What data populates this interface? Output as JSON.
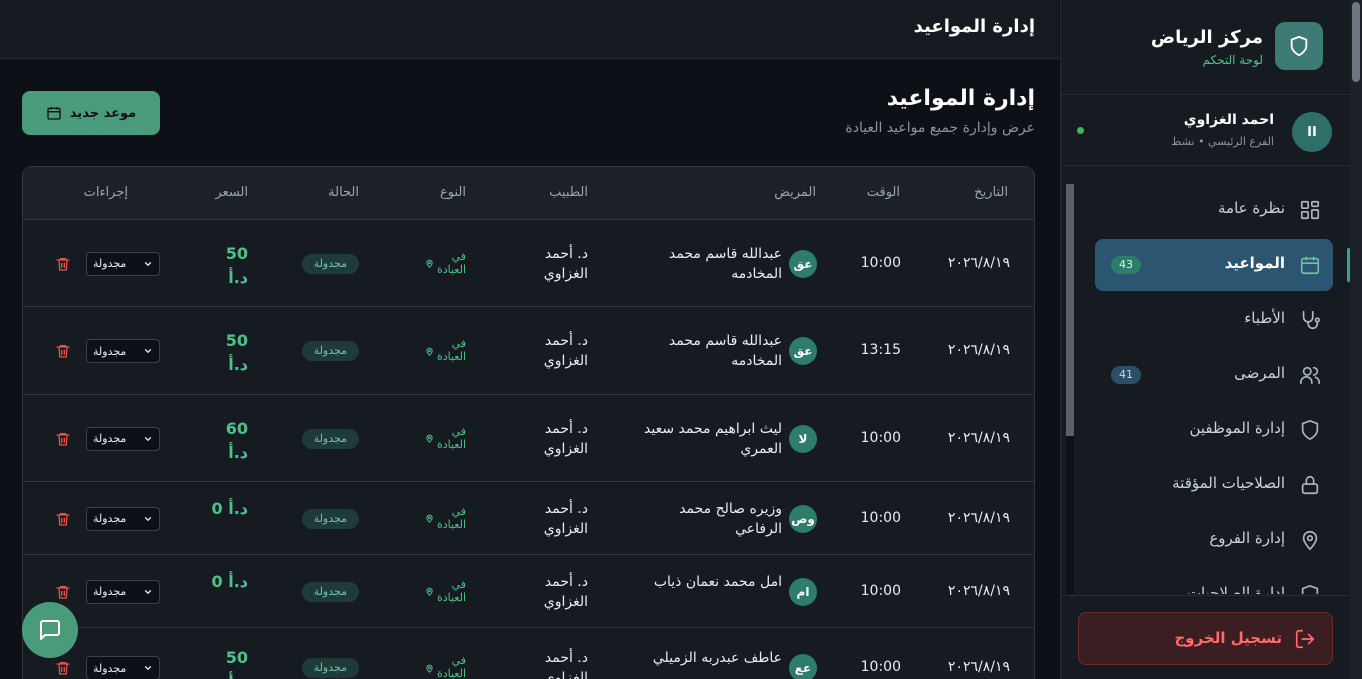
{
  "topbar": {
    "title": "إدارة المواعيد"
  },
  "brand": {
    "title": "مركز الرياض",
    "subtitle": "لوحة التحكم",
    "logo_icon": "shield-icon"
  },
  "user": {
    "initials": "II",
    "name": "احمد الغزاوي",
    "meta": "الفرع الرئيسي • نشط"
  },
  "nav": [
    {
      "label": "نظرة عامة",
      "icon": "grid-icon"
    },
    {
      "label": "المواعيد",
      "icon": "calendar-icon",
      "badge": "43",
      "active": true
    },
    {
      "label": "الأطباء",
      "icon": "stethoscope-icon"
    },
    {
      "label": "المرضى",
      "icon": "users-icon",
      "badge": "41"
    },
    {
      "label": "إدارة الموظفين",
      "icon": "shield-icon"
    },
    {
      "label": "الصلاحيات المؤقتة",
      "icon": "lock-icon"
    },
    {
      "label": "إدارة الفروع",
      "icon": "map-pin-icon"
    },
    {
      "label": "إدارة الصلاحيات",
      "icon": "shield-icon"
    }
  ],
  "logout": {
    "label": "تسجيل الخروج"
  },
  "page": {
    "title": "إدارة المواعيد",
    "subtitle": "عرض وإدارة جميع مواعيد العيادة",
    "new_button": "موعد جديد"
  },
  "table": {
    "headers": {
      "date": "التاريخ",
      "time": "الوقت",
      "patient": "المريض",
      "doctor": "الطبيب",
      "type": "النوع",
      "status": "الحالة",
      "price": "السعر",
      "actions": "إجراءات"
    },
    "rows": [
      {
        "date": "٢٠٢٦/٨/١٩",
        "time": "10:00",
        "initials": "عق",
        "patient_l1": "عبدالله قاسم محمد",
        "patient_l2": "المخادمه",
        "doctor_l1": "د. أحمد",
        "doctor_l2": "الغزاوي",
        "type_l1": "في",
        "type_l2": "العيادة",
        "status": "مجدولة",
        "price_l1": "50",
        "price_l2": "د.أ",
        "select": "مجدولة"
      },
      {
        "date": "٢٠٢٦/٨/١٩",
        "time": "13:15",
        "initials": "عق",
        "patient_l1": "عبدالله قاسم محمد",
        "patient_l2": "المخادمه",
        "doctor_l1": "د. أحمد",
        "doctor_l2": "الغزاوي",
        "type_l1": "في",
        "type_l2": "العيادة",
        "status": "مجدولة",
        "price_l1": "50",
        "price_l2": "د.أ",
        "select": "مجدولة"
      },
      {
        "date": "٢٠٢٦/٨/١٩",
        "time": "10:00",
        "initials": "لا",
        "patient_l1": "ليث ابراهيم محمد سعيد",
        "patient_l2": "العمري",
        "doctor_l1": "د. أحمد",
        "doctor_l2": "الغزاوي",
        "type_l1": "في",
        "type_l2": "العيادة",
        "status": "مجدولة",
        "price_l1": "60",
        "price_l2": "د.أ",
        "select": "مجدولة"
      },
      {
        "date": "٢٠٢٦/٨/١٩",
        "time": "10:00",
        "initials": "وص",
        "patient_l1": "وزيره صالح محمد",
        "patient_l2": "الرفاعي",
        "doctor_l1": "د. أحمد",
        "doctor_l2": "الغزاوي",
        "type_l1": "في",
        "type_l2": "العيادة",
        "status": "مجدولة",
        "price_l1": "0 د.أ",
        "price_l2": "",
        "select": "مجدولة"
      },
      {
        "date": "٢٠٢٦/٨/١٩",
        "time": "10:00",
        "initials": "ام",
        "patient_l1": "امل محمد نعمان ذياب",
        "patient_l2": "",
        "doctor_l1": "د. أحمد",
        "doctor_l2": "الغزاوي",
        "type_l1": "في",
        "type_l2": "العيادة",
        "status": "مجدولة",
        "price_l1": "0 د.أ",
        "price_l2": "",
        "select": "مجدولة"
      },
      {
        "date": "٢٠٢٦/٨/١٩",
        "time": "10:00",
        "initials": "عع",
        "patient_l1": "عاطف عبدربه الزميلي",
        "patient_l2": "",
        "doctor_l1": "د. أحمد",
        "doctor_l2": "الغزاوي",
        "type_l1": "في",
        "type_l2": "العيادة",
        "status": "مجدولة",
        "price_l1": "50",
        "price_l2": "د.أ",
        "select": "مجدولة"
      }
    ]
  }
}
